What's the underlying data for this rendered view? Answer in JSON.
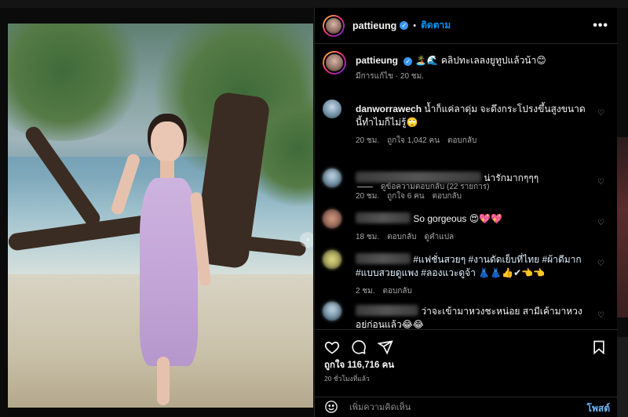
{
  "post": {
    "author": "pattieung",
    "follow_label": "ติดตาม",
    "dot": "•",
    "more": "•••"
  },
  "caption": {
    "username": "pattieung",
    "text": "🏝️🌊 คลิปทะเลลงยูทูปแล้วน้า😊",
    "edited": "มีการแก้ไข · 20 ชม."
  },
  "comments": [
    {
      "username": "danworrawech",
      "text": "น้ำก็แค่ลาดุ่ม จะดึงกระโปรงขึ้นสูงขนาดนี้ทำไมก็ไม่รู้🙄",
      "time": "20 ชม.",
      "likes": "ถูกใจ 1,042 คน",
      "reply": "ตอบกลับ"
    },
    {
      "text": "น่ารักมากๆๆๆ",
      "time": "20 ชม.",
      "likes": "ถูกใจ 6 คน",
      "reply": "ตอบกลับ"
    },
    {
      "text": "So gorgeous 😍💖💖",
      "time": "18 ชม.",
      "reply": "ตอบกลับ",
      "translate": "ดูคำแปล"
    },
    {
      "text": "#แฟชั่นสวยๆ #งานดัดเย็บที่ไทย #ผ้าดีมาก #แบบสวยดูแพง #ลองแวะดูจ้า 👗👗👍✔👈👈",
      "time": "2 ชม.",
      "reply": "ตอบกลับ"
    },
    {
      "text": "ว่าจะเข้ามาหวงชะหน่อย สามีเค้ามาหวงอยู่ก่อนแล้ว😂😂"
    }
  ],
  "view_replies": "ดูข้อความตอบกลับ (22 รายการ)",
  "likes_total": "ถูกใจ 116,716 คน",
  "posted_ago": "20 ชั่วโมงที่แล้ว",
  "composer": {
    "placeholder": "เพิ่มความคิดเห็น",
    "post_label": "โพสต์"
  },
  "icons": {
    "like": "heart-icon",
    "comment": "comment-icon",
    "share": "paper-plane-icon",
    "save": "bookmark-icon",
    "emoji": "smiley-icon",
    "verified": "verified-badge-icon",
    "next": "chevron-right-icon"
  },
  "colors": {
    "accent": "#0095f6",
    "background": "#000000",
    "muted": "#a8a8a8"
  }
}
